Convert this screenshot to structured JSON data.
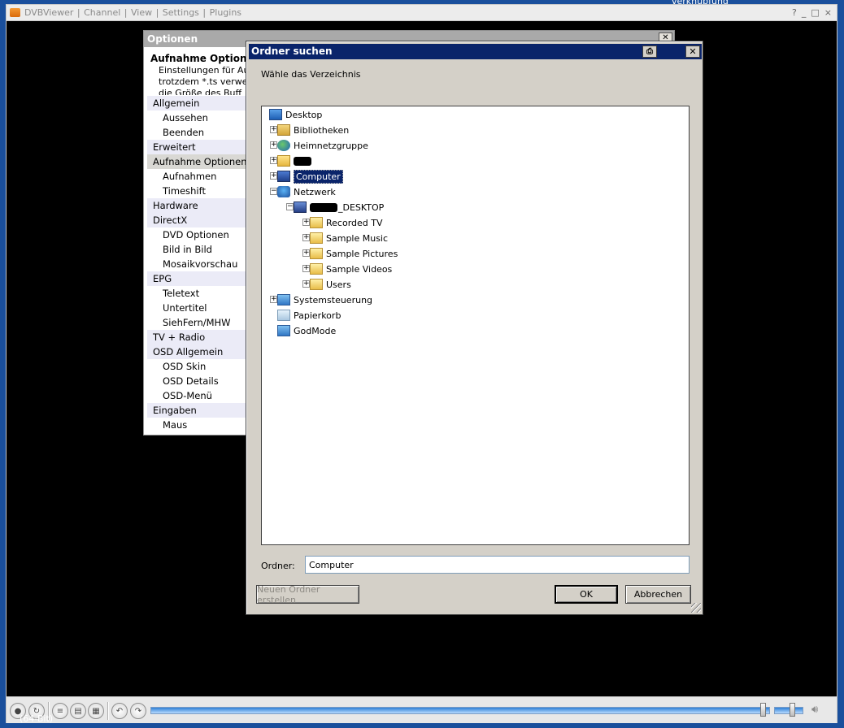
{
  "desktop": {
    "top_text": "verknüpfung",
    "bottom_text": "(64-Bit)"
  },
  "main_window": {
    "menu": [
      "DVBViewer",
      "Channel",
      "View",
      "Settings",
      "Plugins"
    ],
    "controls": [
      "?",
      "_",
      "□",
      "×"
    ],
    "toolbar_icons": [
      "record-icon",
      "timeshift-icon",
      "playlist-icon",
      "list-icon",
      "channel-list-icon",
      "rewind-icon",
      "forward-icon",
      "speaker-icon"
    ],
    "seek_progress": 0.99,
    "volume_level": 0.55
  },
  "options": {
    "title": "Optionen",
    "close_label": "✕",
    "head_title": "Aufnahme Optionen",
    "head_lines": [
      "Einstellungen für Au",
      "trotzdem *.ts verwer",
      "die Größe des Buff"
    ],
    "nav": [
      {
        "label": "Allgemein",
        "type": "cat"
      },
      {
        "label": "Aussehen",
        "type": "sub"
      },
      {
        "label": "Beenden",
        "type": "sub"
      },
      {
        "label": "Erweitert",
        "type": "cat"
      },
      {
        "label": "Aufnahme Optionen",
        "type": "cat",
        "active": true
      },
      {
        "label": "Aufnahmen",
        "type": "sub"
      },
      {
        "label": "Timeshift",
        "type": "sub"
      },
      {
        "label": "Hardware",
        "type": "cat"
      },
      {
        "label": "DirectX",
        "type": "cat"
      },
      {
        "label": "DVD Optionen",
        "type": "sub"
      },
      {
        "label": "Bild in Bild",
        "type": "sub"
      },
      {
        "label": "Mosaikvorschau",
        "type": "sub"
      },
      {
        "label": "EPG",
        "type": "cat"
      },
      {
        "label": "Teletext",
        "type": "sub"
      },
      {
        "label": "Untertitel",
        "type": "sub"
      },
      {
        "label": "SiehFern/MHW",
        "type": "sub"
      },
      {
        "label": "TV + Radio",
        "type": "cat"
      },
      {
        "label": "OSD Allgemein",
        "type": "cat"
      },
      {
        "label": "OSD Skin",
        "type": "sub"
      },
      {
        "label": "OSD Details",
        "type": "sub"
      },
      {
        "label": "OSD-Menü",
        "type": "sub"
      },
      {
        "label": "Eingaben",
        "type": "cat"
      },
      {
        "label": "Maus",
        "type": "sub"
      }
    ]
  },
  "folder_dialog": {
    "title": "Ordner suchen",
    "help_icon": "printer-icon",
    "close_label": "✕",
    "instruction": "Wähle das Verzeichnis",
    "tree": [
      {
        "label": "Desktop",
        "icon": "desktop-icon",
        "level": 0,
        "expander": ""
      },
      {
        "label": "Bibliotheken",
        "icon": "library-icon",
        "level": 1,
        "expander": "+"
      },
      {
        "label": "Heimnetzgruppe",
        "icon": "homegroup-icon",
        "level": 1,
        "expander": "+"
      },
      {
        "label": "",
        "icon": "user-folder-icon",
        "level": 1,
        "expander": "+",
        "redacted": true
      },
      {
        "label": "Computer",
        "icon": "computer-icon",
        "level": 1,
        "expander": "+",
        "selected": true
      },
      {
        "label": "Netzwerk",
        "icon": "network-icon",
        "level": 1,
        "expander": "−"
      },
      {
        "label": "_DESKTOP",
        "icon": "pc-icon",
        "level": 2,
        "expander": "−",
        "redacted_prefix": true
      },
      {
        "label": "Recorded TV",
        "icon": "shared-folder-icon",
        "level": 3,
        "expander": "+"
      },
      {
        "label": "Sample Music",
        "icon": "shared-folder-icon",
        "level": 3,
        "expander": "+"
      },
      {
        "label": "Sample Pictures",
        "icon": "shared-folder-icon",
        "level": 3,
        "expander": "+"
      },
      {
        "label": "Sample Videos",
        "icon": "shared-folder-icon",
        "level": 3,
        "expander": "+"
      },
      {
        "label": "Users",
        "icon": "shared-folder-icon",
        "level": 3,
        "expander": "+"
      },
      {
        "label": "Systemsteuerung",
        "icon": "control-panel-icon",
        "level": 1,
        "expander": "+"
      },
      {
        "label": "Papierkorb",
        "icon": "recycle-bin-icon",
        "level": 1,
        "expander": ""
      },
      {
        "label": "GodMode",
        "icon": "godmode-icon",
        "level": 1,
        "expander": ""
      }
    ],
    "folder_label": "Ordner:",
    "folder_value": "Computer",
    "new_folder_button": "Neuen Ordner erstellen",
    "ok_button": "OK",
    "cancel_button": "Abbrechen"
  }
}
